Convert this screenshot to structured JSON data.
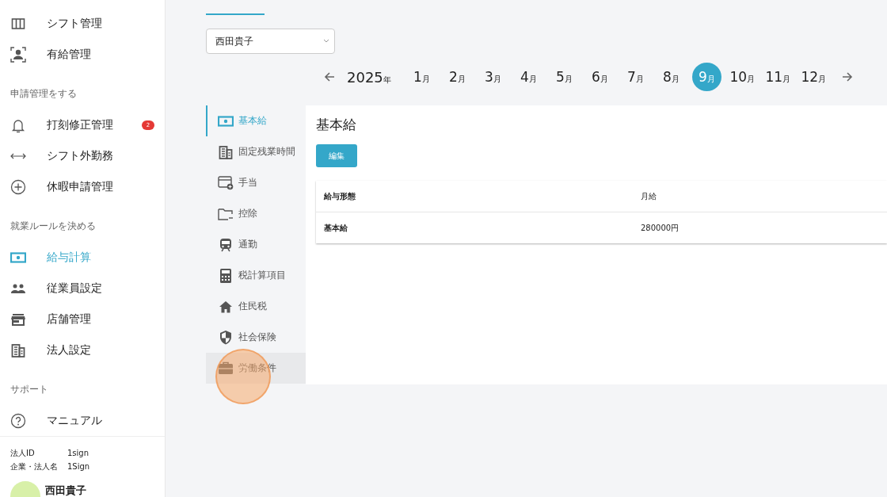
{
  "sidebar": {
    "sections": [
      {
        "items": [
          {
            "label": "シフト管理",
            "selected": false
          },
          {
            "label": "有給管理",
            "selected": false
          }
        ]
      },
      {
        "heading": "申請管理をする",
        "items": [
          {
            "label": "打刻修正管理",
            "selected": false,
            "badge": "2"
          },
          {
            "label": "シフト外勤務",
            "selected": false
          },
          {
            "label": "休暇申請管理",
            "selected": false
          }
        ]
      },
      {
        "heading": "就業ルールを決める",
        "items": [
          {
            "label": "給与計算",
            "selected": true
          },
          {
            "label": "従業員設定",
            "selected": false
          },
          {
            "label": "店舗管理",
            "selected": false
          },
          {
            "label": "法人設定",
            "selected": false
          }
        ]
      },
      {
        "heading": "サポート",
        "items": [
          {
            "label": "マニュアル",
            "selected": false
          }
        ]
      }
    ],
    "footer": {
      "rows": [
        {
          "label": "法人ID",
          "value": "1sign"
        },
        {
          "label": "企業・法人名",
          "value": "1Sign"
        }
      ],
      "user_name": "西田貴子"
    }
  },
  "employee_select": {
    "value": "西田貴子"
  },
  "month_nav": {
    "year": "2025",
    "year_unit": "年",
    "months": [
      {
        "number": "1",
        "unit": "月",
        "selected": false
      },
      {
        "number": "2",
        "unit": "月",
        "selected": false
      },
      {
        "number": "3",
        "unit": "月",
        "selected": false
      },
      {
        "number": "4",
        "unit": "月",
        "selected": false
      },
      {
        "number": "5",
        "unit": "月",
        "selected": false
      },
      {
        "number": "6",
        "unit": "月",
        "selected": false
      },
      {
        "number": "7",
        "unit": "月",
        "selected": false
      },
      {
        "number": "8",
        "unit": "月",
        "selected": false
      },
      {
        "number": "9",
        "unit": "月",
        "selected": true
      },
      {
        "number": "10",
        "unit": "月",
        "selected": false
      },
      {
        "number": "11",
        "unit": "月",
        "selected": false
      },
      {
        "number": "12",
        "unit": "月",
        "selected": false
      }
    ]
  },
  "sub_nav": [
    {
      "label": "基本給",
      "selected": true,
      "hovered": false
    },
    {
      "label": "固定残業時間",
      "selected": false,
      "hovered": false
    },
    {
      "label": "手当",
      "selected": false,
      "hovered": false
    },
    {
      "label": "控除",
      "selected": false,
      "hovered": false
    },
    {
      "label": "通勤",
      "selected": false,
      "hovered": false
    },
    {
      "label": "税計算項目",
      "selected": false,
      "hovered": false
    },
    {
      "label": "住民税",
      "selected": false,
      "hovered": false
    },
    {
      "label": "社会保険",
      "selected": false,
      "hovered": false
    },
    {
      "label": "労働条件",
      "selected": false,
      "hovered": true
    }
  ],
  "panel": {
    "title": "基本給",
    "edit_button": "編集",
    "table": {
      "rows": [
        {
          "label": "給与形態",
          "value": "月給"
        },
        {
          "label": "基本給",
          "value": "280000円"
        }
      ]
    }
  },
  "click_marker": true
}
